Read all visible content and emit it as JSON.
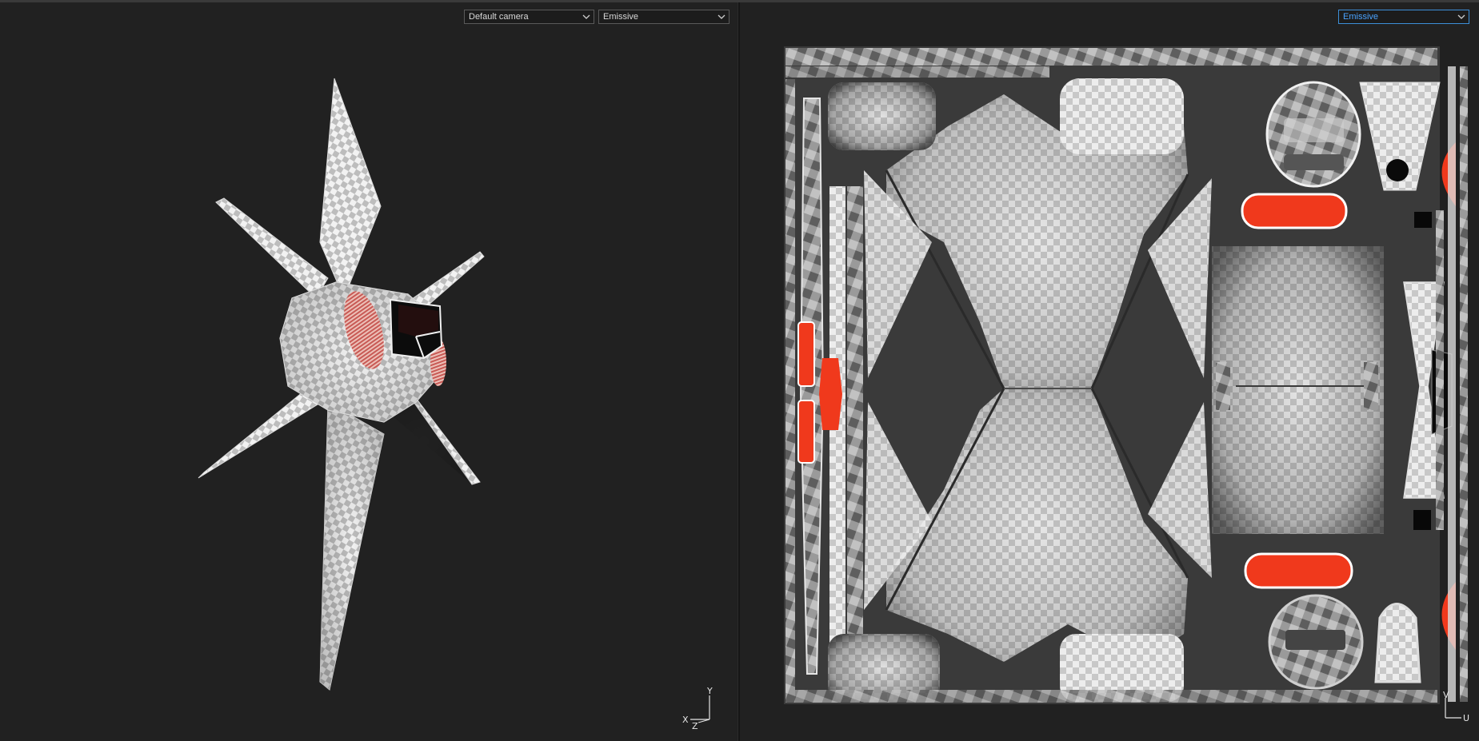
{
  "viewport_3d": {
    "camera_select": "Default camera",
    "channel_select": "Emissive",
    "gizmo": {
      "x": "X",
      "y": "Y",
      "z": "Z"
    }
  },
  "viewport_uv": {
    "channel_select": "Emissive",
    "gizmo": {
      "u": "U",
      "v": "V"
    }
  },
  "colors": {
    "background": "#212121",
    "emissive_red": "#f0391c",
    "active_border": "#3c8fd8"
  }
}
